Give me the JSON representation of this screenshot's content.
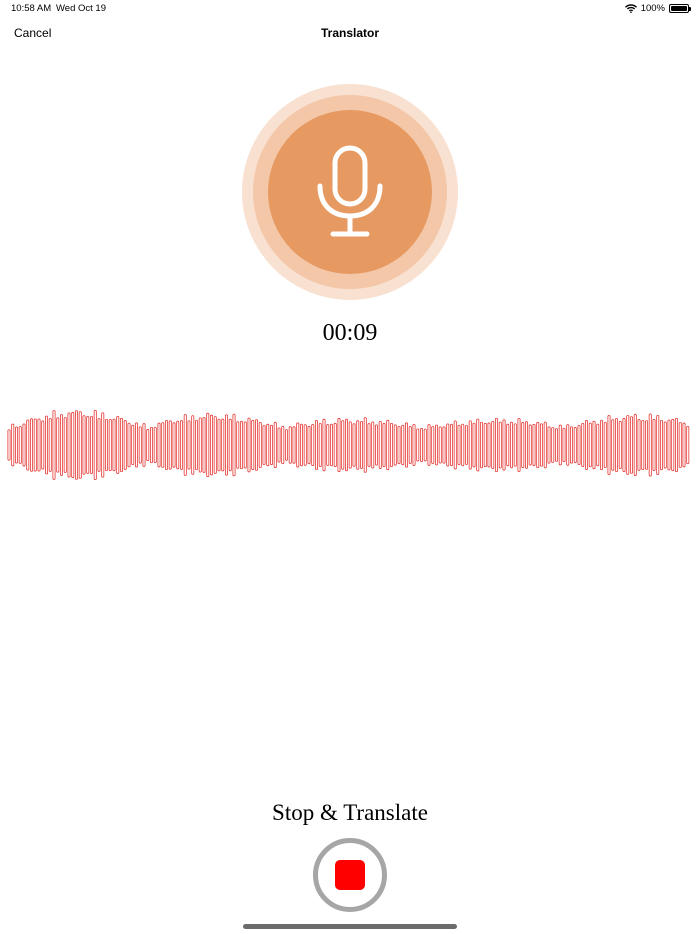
{
  "status_bar": {
    "time": "10:58 AM",
    "date": "Wed Oct 19",
    "battery": "100%",
    "wifi_icon": "wifi-icon",
    "battery_icon": "battery-icon"
  },
  "nav": {
    "cancel_label": "Cancel",
    "title": "Translator"
  },
  "recorder": {
    "mic_icon": "microphone-icon",
    "elapsed": "00:09",
    "waveform_color": "#e53935",
    "accent_color": "#e69960"
  },
  "stop": {
    "label": "Stop & Translate",
    "icon": "stop-icon",
    "color": "#ff0000"
  }
}
